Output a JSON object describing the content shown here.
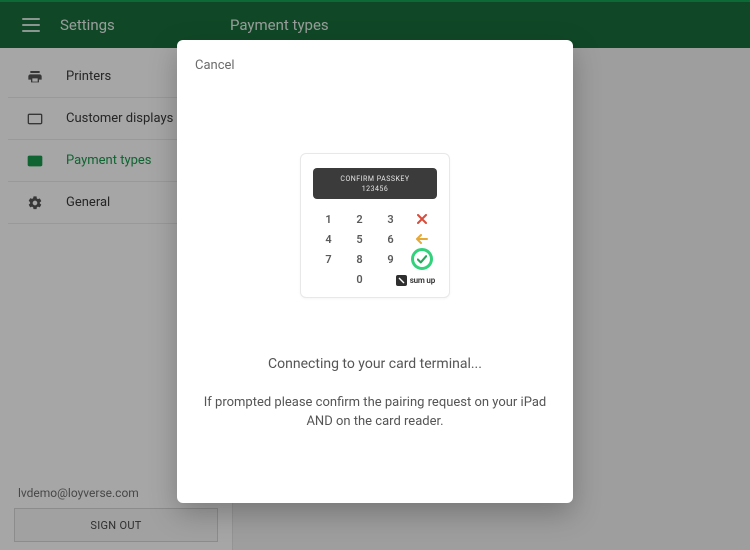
{
  "header": {
    "left": "Settings",
    "right": "Payment types"
  },
  "sidebar": {
    "items": [
      {
        "label": "Printers"
      },
      {
        "label": "Customer displays"
      },
      {
        "label": "Payment types"
      },
      {
        "label": "General"
      }
    ],
    "user_email": "lvdemo@loyverse.com",
    "signout_label": "SIGN OUT"
  },
  "modal": {
    "cancel_label": "Cancel",
    "reader": {
      "lcd_line1": "CONFIRM PASSKEY",
      "lcd_line2": "123456",
      "brand": "sum up"
    },
    "status_text": "Connecting to your card terminal...",
    "hint_text": "If prompted please confirm the pairing request on your iPad AND on the card reader."
  }
}
